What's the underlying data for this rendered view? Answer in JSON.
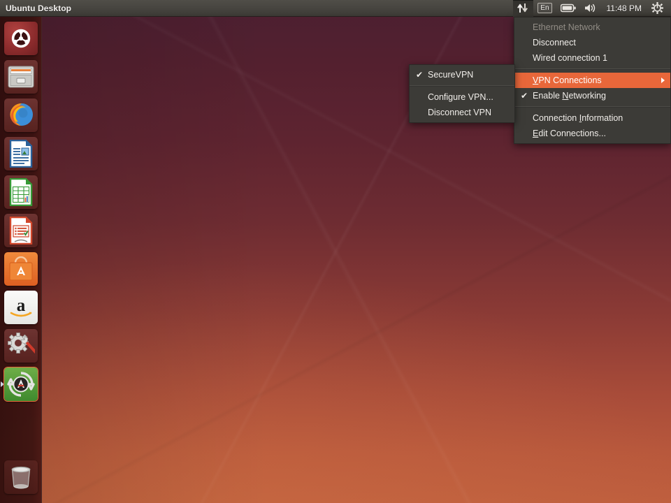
{
  "panel": {
    "title": "Ubuntu Desktop",
    "indicators": [
      {
        "name": "network-indicator",
        "icon": "network-arrows-icon",
        "label": ""
      },
      {
        "name": "keyboard-indicator",
        "icon": "keyboard-layout-icon",
        "label": "En"
      },
      {
        "name": "battery-indicator",
        "icon": "battery-icon",
        "label": ""
      },
      {
        "name": "sound-indicator",
        "icon": "volume-icon",
        "label": ""
      },
      {
        "name": "clock-indicator",
        "icon": "clock-icon",
        "label": "11:48 PM"
      },
      {
        "name": "session-indicator",
        "icon": "gear-power-icon",
        "label": ""
      }
    ],
    "clock": "11:48 PM",
    "keyboard_layout": "En"
  },
  "launcher": {
    "items": [
      {
        "label": "Dash home",
        "icon": "ubuntu-logo-icon",
        "running": false
      },
      {
        "label": "Files",
        "icon": "file-manager-icon",
        "running": false
      },
      {
        "label": "Firefox Web Browser",
        "icon": "firefox-icon",
        "running": false
      },
      {
        "label": "LibreOffice Writer",
        "icon": "libreoffice-writer-icon",
        "running": false
      },
      {
        "label": "LibreOffice Calc",
        "icon": "libreoffice-calc-icon",
        "running": false
      },
      {
        "label": "LibreOffice Impress",
        "icon": "libreoffice-impress-icon",
        "running": false
      },
      {
        "label": "Ubuntu Software Center",
        "icon": "software-center-icon",
        "running": false
      },
      {
        "label": "Amazon",
        "icon": "amazon-icon",
        "running": false
      },
      {
        "label": "System Settings",
        "icon": "system-settings-icon",
        "running": false
      },
      {
        "label": "Software Updater",
        "icon": "software-updater-icon",
        "running": true
      }
    ],
    "trash": {
      "label": "Trash",
      "icon": "trash-icon"
    }
  },
  "network_menu": {
    "items": [
      {
        "label": "Ethernet Network",
        "type": "header",
        "disabled": true,
        "checked": false,
        "highlighted": false,
        "submenu": false
      },
      {
        "label": "Disconnect",
        "type": "item",
        "disabled": false,
        "checked": false,
        "highlighted": false,
        "submenu": false
      },
      {
        "label": "Wired connection 1",
        "type": "item",
        "disabled": false,
        "checked": false,
        "highlighted": false,
        "submenu": false
      },
      {
        "type": "separator"
      },
      {
        "label": "VPN Connections",
        "type": "item",
        "disabled": false,
        "checked": false,
        "highlighted": true,
        "submenu": true,
        "mnemonic": "V"
      },
      {
        "label": "Enable Networking",
        "type": "item",
        "disabled": false,
        "checked": true,
        "highlighted": false,
        "submenu": false,
        "mnemonic": "N"
      },
      {
        "type": "separator"
      },
      {
        "label": "Connection Information",
        "type": "item",
        "disabled": false,
        "checked": false,
        "highlighted": false,
        "submenu": false,
        "mnemonic": "I"
      },
      {
        "label": "Edit Connections...",
        "type": "item",
        "disabled": false,
        "checked": false,
        "highlighted": false,
        "submenu": false,
        "mnemonic": "E"
      }
    ]
  },
  "vpn_submenu": {
    "items": [
      {
        "label": "SecureVPN",
        "checked": true,
        "type": "item"
      },
      {
        "type": "separator"
      },
      {
        "label": "Configure VPN...",
        "checked": false,
        "type": "item"
      },
      {
        "label": "Disconnect VPN",
        "checked": false,
        "type": "item"
      }
    ]
  },
  "colors": {
    "menu_background": "#3c3b37",
    "menu_highlight": "#e8673a",
    "panel_background": "#474540",
    "launcher_background": "#38110f",
    "text": "#f0ede9",
    "text_disabled": "#918c85"
  }
}
